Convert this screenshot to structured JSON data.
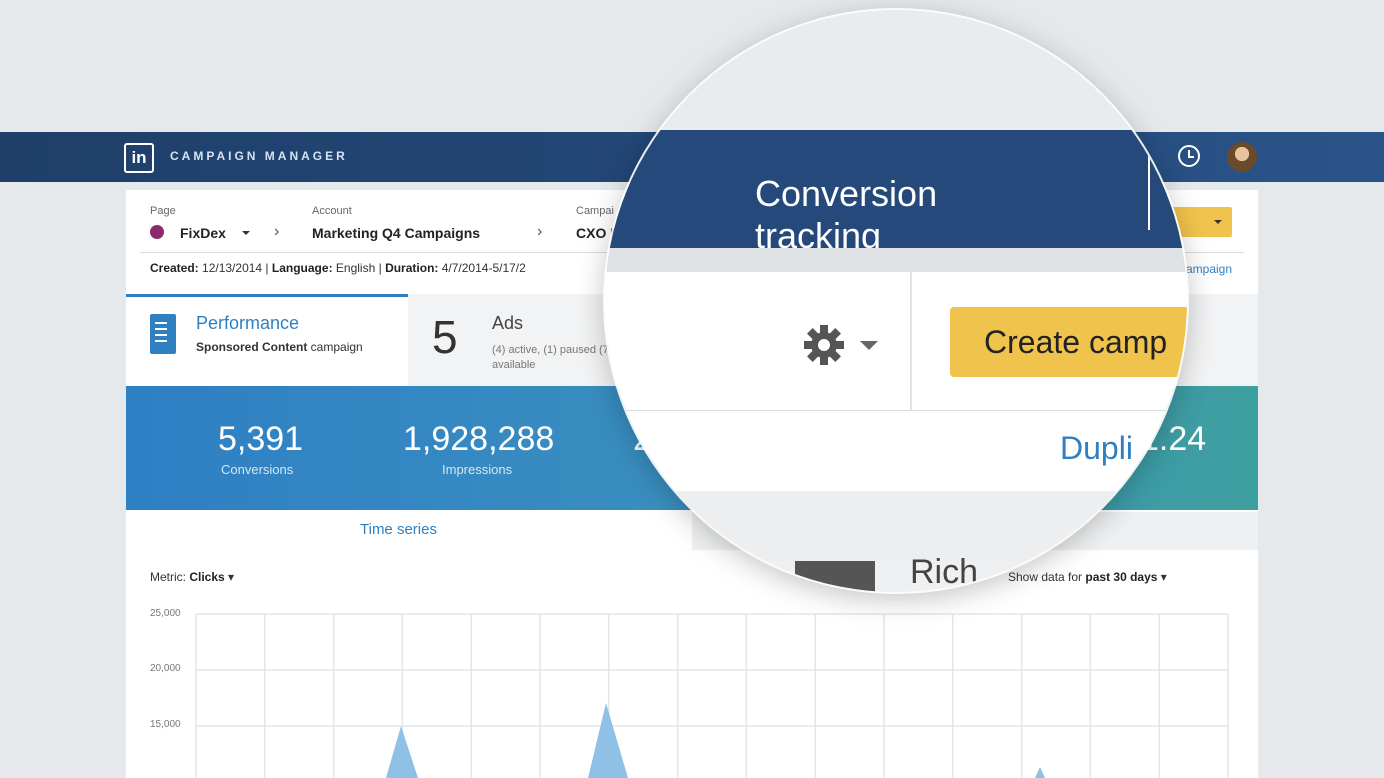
{
  "header": {
    "logo_text": "in",
    "brand": "CAMPAIGN MANAGER"
  },
  "breadcrumb": {
    "page_label": "Page",
    "page_value": "FixDex",
    "account_label": "Account",
    "account_value": "Marketing Q4 Campaigns",
    "campaign_label": "Campai",
    "campaign_value": "CXO M"
  },
  "meta": {
    "created_label": "Created:",
    "created_value": "12/13/2014",
    "language_label": "Language:",
    "language_value": "English",
    "duration_label": "Duration:",
    "duration_value": "4/7/2014-5/17/2"
  },
  "tabs": {
    "performance_title": "Performance",
    "performance_sub_bold": "Sponsored Content",
    "performance_sub": "campaign",
    "ads_count": "5",
    "ads_label": "Ads",
    "ads_detail": "(4) active, (1) paused (73) available"
  },
  "metrics": [
    {
      "value": "5,391",
      "label": "Conversions"
    },
    {
      "value": "1,928,288",
      "label": "Impressions"
    },
    {
      "value": "2",
      "label": ""
    }
  ],
  "metric_right_value": "1.24",
  "chart_section": {
    "time_series": "Time series",
    "metric_label": "Metric:",
    "metric_value": "Clicks",
    "show_label": "Show data for",
    "show_value": "past 30 days",
    "y_ticks": [
      "25,000",
      "20,000",
      "15,000"
    ]
  },
  "magnifier": {
    "title": "Conversion tracking",
    "create_button": "Create camp",
    "duplicate_link": "Dupli",
    "rich_text": "Rich"
  },
  "behind": {
    "campaign_link": "campaign"
  },
  "colors": {
    "nav": "#24497a",
    "accent": "#2f7fc1",
    "button": "#f0c44c"
  }
}
